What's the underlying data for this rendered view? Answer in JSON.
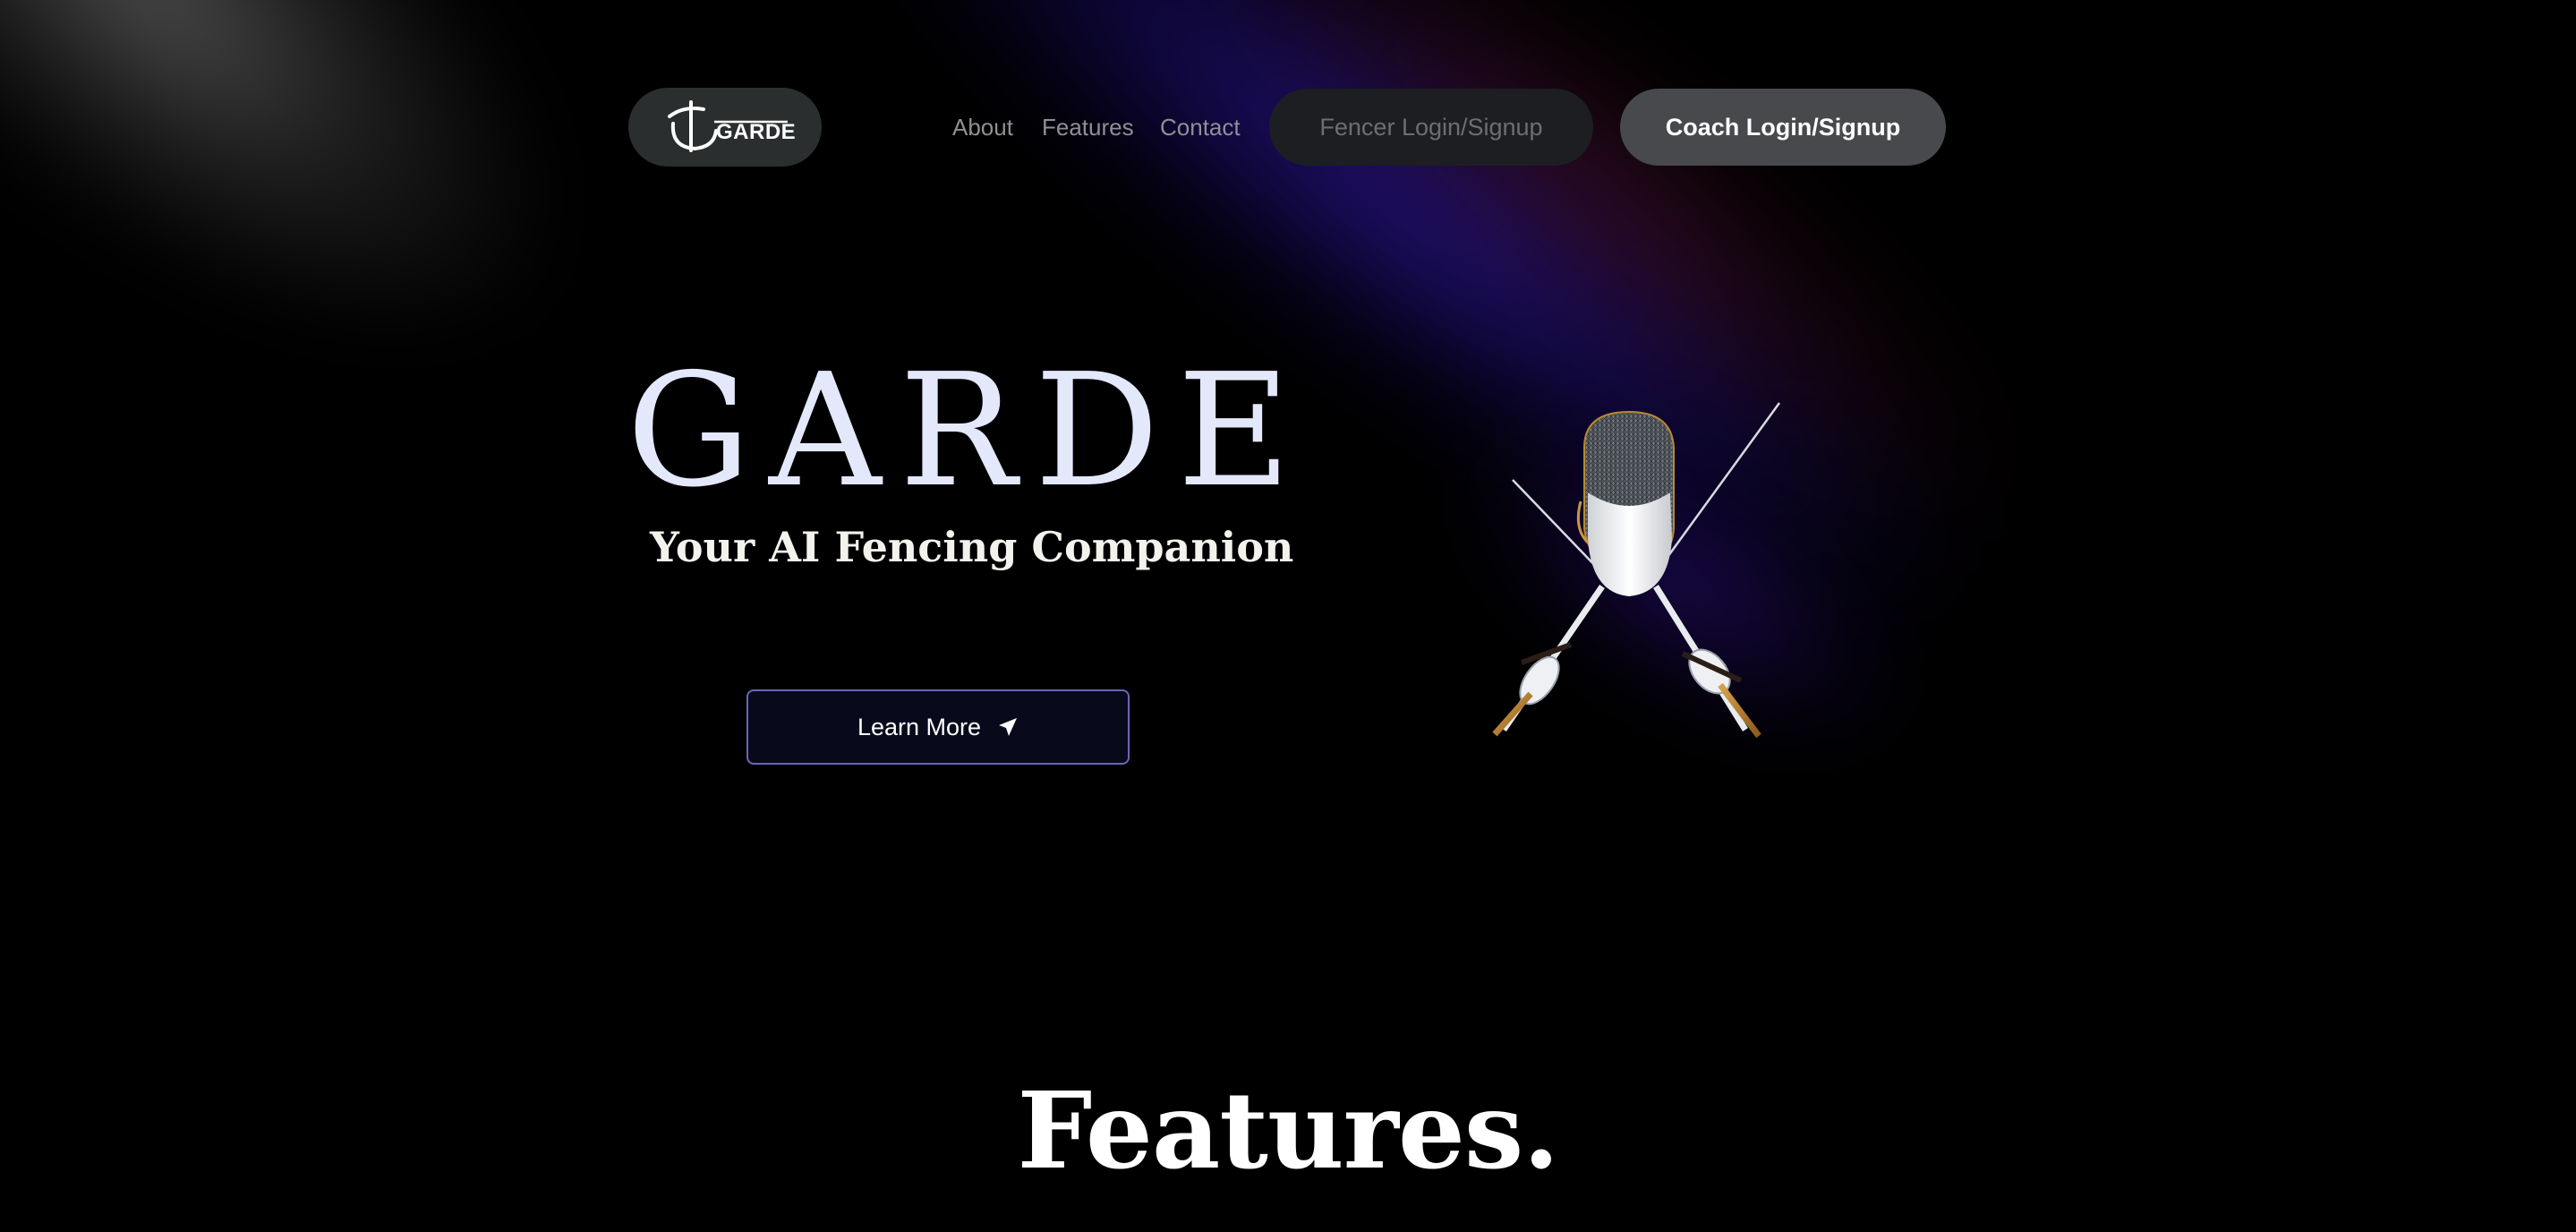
{
  "nav": {
    "logo_text": "GARDE",
    "links": [
      {
        "label": "About"
      },
      {
        "label": "Features"
      },
      {
        "label": "Contact"
      }
    ],
    "fencer_button": "Fencer Login/Signup",
    "coach_button": "Coach Login/Signup"
  },
  "hero": {
    "title": "GARDE",
    "subtitle": "Your AI Fencing Companion",
    "cta_label": "Learn More",
    "cta_icon": "send-arrow-icon",
    "illustration": "fencing-mask-crossed-foils"
  },
  "features": {
    "heading": "Features."
  },
  "colors": {
    "background": "#000000",
    "title": "#e4e8fb",
    "accent_border": "#6c64b8",
    "fencer_button_bg": "#1d1e21",
    "coach_button_bg": "#48494c",
    "logo_pill_bg": "#2a2e2e"
  }
}
